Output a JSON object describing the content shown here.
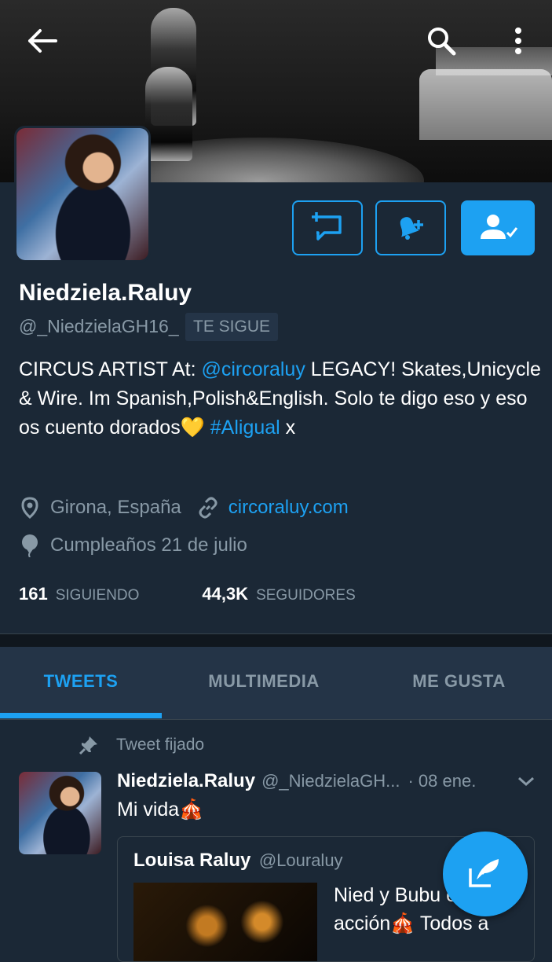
{
  "profile": {
    "name": "Niedziela.Raluy",
    "handle": "@_NiedzielaGH16_",
    "follows_you": "TE SIGUE",
    "bio": {
      "part1": "CIRCUS ARTIST At: ",
      "mention": "@circoraluy",
      "part2": " LEGACY! Skates,Unicycle & Wire. Im Spanish,Polish&English. Solo te digo eso y eso os cuento dorados💛 ",
      "hashtag": "#Aligual",
      "part3": " x"
    },
    "location": "Girona, España",
    "website": "circoraluy.com",
    "birthday": "Cumpleaños 21 de julio",
    "following_count": "161",
    "following_label": "SIGUIENDO",
    "followers_count": "44,3K",
    "followers_label": "SEGUIDORES"
  },
  "tabs": [
    "TWEETS",
    "MULTIMEDIA",
    "ME GUSTA"
  ],
  "pinned_label": "Tweet fijado",
  "tweet": {
    "name": "Niedziela.Raluy",
    "handle": "@_NiedzielaGH...",
    "date": "· 08 ene.",
    "text": "Mi vida🎪",
    "quote": {
      "name": "Louisa Raluy",
      "handle": "@Louraluy",
      "text": "Nied y Bubu en acción🎪 Todos a"
    }
  },
  "icons": {
    "back": "arrow-left-icon",
    "search": "search-icon",
    "more": "more-vertical-icon",
    "message": "direct-message-icon",
    "notifications": "bell-plus-icon",
    "following": "user-check-icon",
    "location": "location-pin-icon",
    "link": "link-icon",
    "birthday": "balloon-icon",
    "pin": "pin-icon",
    "caret": "chevron-down-icon",
    "compose": "compose-tweet-icon"
  },
  "colors": {
    "background": "#1b2836",
    "accent": "#1da1f2",
    "secondary_text": "#8899a6"
  }
}
